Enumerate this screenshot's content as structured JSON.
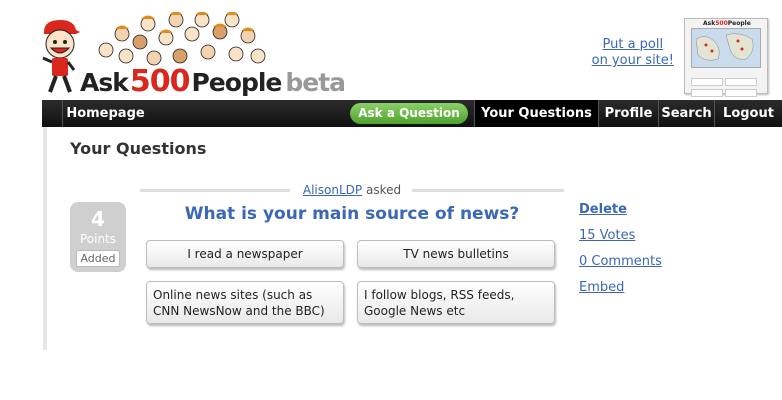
{
  "brand": {
    "logo_word1": "Ask",
    "logo_word2": "500",
    "logo_word3": "People",
    "logo_word4": "beta"
  },
  "header": {
    "put_poll_line1": "Put a poll",
    "put_poll_line2": "on your site!",
    "thumb_logo_a": "Ask",
    "thumb_logo_b": "500",
    "thumb_logo_c": "People"
  },
  "nav": {
    "items": [
      {
        "label": "Homepage"
      },
      {
        "label": "Your Questions"
      },
      {
        "label": "Profile"
      },
      {
        "label": "Search"
      },
      {
        "label": "Logout"
      }
    ],
    "ask_button": "Ask a Question"
  },
  "page": {
    "title": "Your Questions"
  },
  "question": {
    "author": "AlisonLDP",
    "asked_word": "asked",
    "text": "What is your main source of news?",
    "points_value": "4",
    "points_label": "Points",
    "added_badge": "Added",
    "answers": [
      {
        "label": "I read a newspaper"
      },
      {
        "label": "TV news bulletins"
      },
      {
        "label": "Online news sites (such as CNN NewsNow and the BBC)"
      },
      {
        "label": "I follow blogs, RSS feeds, Google News etc"
      }
    ],
    "actions": {
      "delete": "Delete",
      "votes": "15 Votes",
      "comments": "0 Comments",
      "embed": "Embed"
    }
  },
  "colors": {
    "accent_red": "#d9271e",
    "link_blue": "#3a68b6",
    "nav_black": "#1a1a1a",
    "button_green": "#5fb33a"
  }
}
